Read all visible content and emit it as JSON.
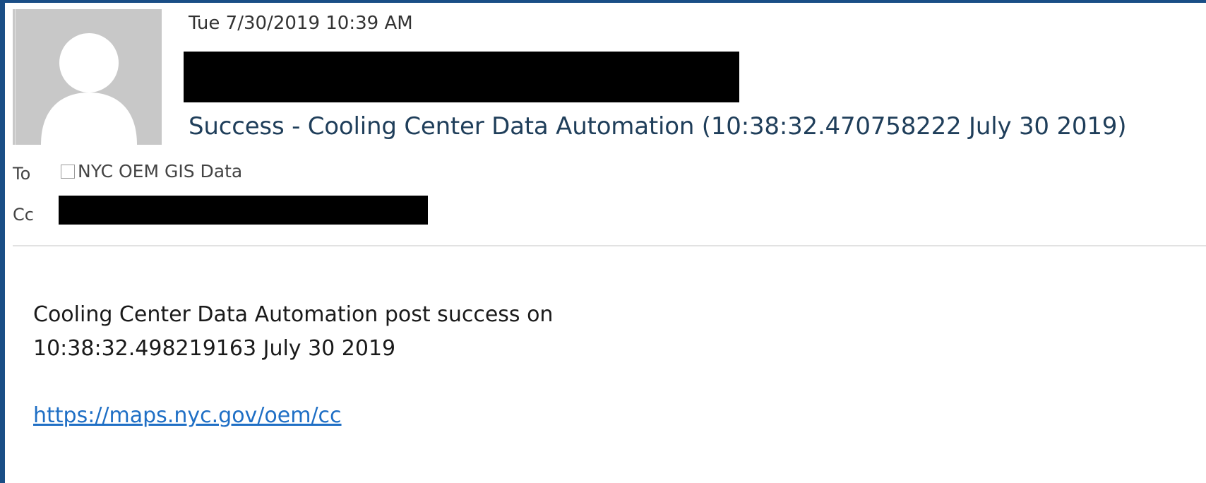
{
  "message": {
    "sent_datetime": "Tue 7/30/2019 10:39 AM",
    "subject": "Success - Cooling Center Data Automation (10:38:32.470758222 July 30 2019)"
  },
  "header": {
    "to_label": "To",
    "cc_label": "Cc",
    "to_recipient": "NYC OEM GIS Data"
  },
  "body": {
    "line1": "Cooling Center Data Automation post success on",
    "line2": "10:38:32.498219163 July 30 2019",
    "link": "https://maps.nyc.gov/oem/cc"
  },
  "colors": {
    "frame": "#1a4e86",
    "subject": "#1f3e5a",
    "link": "#1f6fc5",
    "redaction": "#000000",
    "avatar_bg": "#c8c8c8"
  },
  "icons": {
    "sender_avatar": "person-silhouette-icon",
    "recipient_checkbox": "checkbox-icon"
  }
}
